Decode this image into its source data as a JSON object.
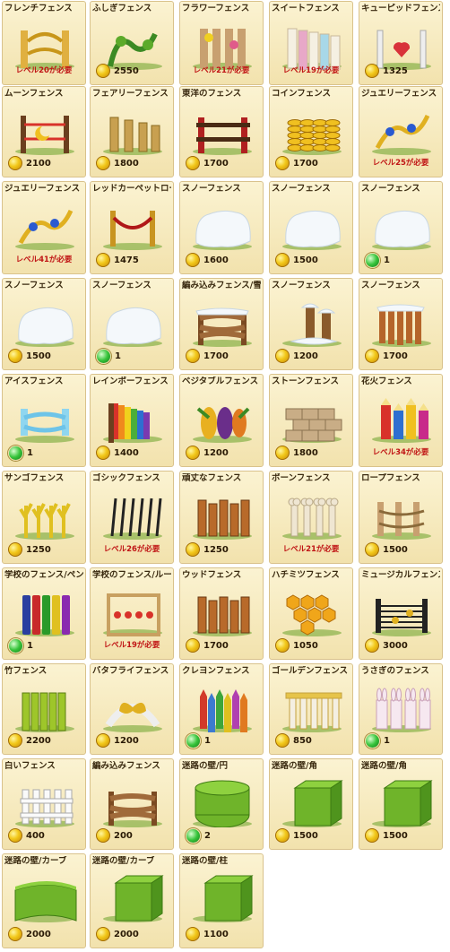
{
  "items": [
    {
      "name": "フレンチフェンス",
      "requirement": "レベル20が必要",
      "art": "ornate-gold"
    },
    {
      "name": "ふしぎフェンス",
      "price": "2550",
      "currency": "coin",
      "art": "vine"
    },
    {
      "name": "フラワーフェンス",
      "requirement": "レベル21が必要",
      "art": "flower"
    },
    {
      "name": "スイートフェンス",
      "requirement": "レベル19が必要",
      "art": "sweet"
    },
    {
      "name": "キューピッドフェンス",
      "price": "1325",
      "currency": "coin",
      "art": "cupid"
    },
    {
      "name": "ムーンフェンス",
      "price": "2100",
      "currency": "coin",
      "art": "moon"
    },
    {
      "name": "フェアリーフェンス",
      "price": "1800",
      "currency": "coin",
      "art": "fairy"
    },
    {
      "name": "東洋のフェンス",
      "price": "1700",
      "currency": "coin",
      "art": "oriental"
    },
    {
      "name": "コインフェンス",
      "price": "1700",
      "currency": "coin",
      "art": "coin-stack"
    },
    {
      "name": "ジュエリーフェンス",
      "requirement": "レベル25が必要",
      "art": "jewel"
    },
    {
      "name": "ジュエリーフェンス",
      "requirement": "レベル41が必要",
      "art": "jewel"
    },
    {
      "name": "レッドカーペットロープ",
      "price": "1475",
      "currency": "coin",
      "art": "red-rope"
    },
    {
      "name": "スノーフェンス",
      "price": "1600",
      "currency": "coin",
      "art": "snow"
    },
    {
      "name": "スノーフェンス",
      "price": "1500",
      "currency": "coin",
      "art": "snow"
    },
    {
      "name": "スノーフェンス",
      "price": "1",
      "currency": "gem",
      "art": "snow"
    },
    {
      "name": "スノーフェンス",
      "price": "1500",
      "currency": "coin",
      "art": "snow"
    },
    {
      "name": "スノーフェンス",
      "price": "1",
      "currency": "gem",
      "art": "snow"
    },
    {
      "name": "編み込みフェンス/雪",
      "price": "1700",
      "currency": "coin",
      "art": "woven-snow"
    },
    {
      "name": "スノーフェンス",
      "price": "1200",
      "currency": "coin",
      "art": "snow-post"
    },
    {
      "name": "スノーフェンス",
      "price": "1700",
      "currency": "coin",
      "art": "picket-snow"
    },
    {
      "name": "アイスフェンス",
      "price": "1",
      "currency": "gem",
      "art": "ice"
    },
    {
      "name": "レインボーフェンス",
      "price": "1400",
      "currency": "coin",
      "art": "rainbow"
    },
    {
      "name": "ベジタブルフェンス",
      "price": "1200",
      "currency": "coin",
      "art": "vegetable"
    },
    {
      "name": "ストーンフェンス",
      "price": "1800",
      "currency": "coin",
      "art": "stone"
    },
    {
      "name": "花火フェンス",
      "requirement": "レベル34が必要",
      "art": "firework"
    },
    {
      "name": "サンゴフェンス",
      "price": "1250",
      "currency": "coin",
      "art": "coral"
    },
    {
      "name": "ゴシックフェンス",
      "requirement": "レベル26が必要",
      "art": "gothic"
    },
    {
      "name": "頑丈なフェンス",
      "price": "1250",
      "currency": "coin",
      "art": "sturdy"
    },
    {
      "name": "ボーンフェンス",
      "requirement": "レベル21が必要",
      "art": "bone"
    },
    {
      "name": "ロープフェンス",
      "price": "1500",
      "currency": "coin",
      "art": "rope"
    },
    {
      "name": "学校のフェンス/ペン",
      "price": "1",
      "currency": "gem",
      "art": "pens"
    },
    {
      "name": "学校のフェンス/ルーラー",
      "requirement": "レベル19が必要",
      "art": "ruler"
    },
    {
      "name": "ウッドフェンス",
      "price": "1700",
      "currency": "coin",
      "art": "wood"
    },
    {
      "name": "ハチミツフェンス",
      "price": "1050",
      "currency": "coin",
      "art": "honey"
    },
    {
      "name": "ミュージカルフェンス",
      "price": "3000",
      "currency": "coin",
      "art": "music"
    },
    {
      "name": "竹フェンス",
      "price": "2200",
      "currency": "coin",
      "art": "bamboo"
    },
    {
      "name": "バタフライフェンス",
      "price": "1200",
      "currency": "coin",
      "art": "butterfly"
    },
    {
      "name": "クレヨンフェンス",
      "price": "1",
      "currency": "gem",
      "art": "crayon"
    },
    {
      "name": "ゴールデンフェンス",
      "price": "850",
      "currency": "coin",
      "art": "golden"
    },
    {
      "name": "うさぎのフェンス",
      "price": "1",
      "currency": "gem",
      "art": "bunny"
    },
    {
      "name": "白いフェンス",
      "price": "400",
      "currency": "coin",
      "art": "white"
    },
    {
      "name": "編み込みフェンス",
      "price": "200",
      "currency": "coin",
      "art": "woven"
    },
    {
      "name": "迷路の壁/円",
      "price": "2",
      "currency": "gem",
      "art": "hedge-round"
    },
    {
      "name": "迷路の壁/角",
      "price": "1500",
      "currency": "coin",
      "art": "hedge-corner"
    },
    {
      "name": "迷路の壁/角",
      "price": "1500",
      "currency": "coin",
      "art": "hedge-corner"
    },
    {
      "name": "迷路の壁/カーブ",
      "price": "2000",
      "currency": "coin",
      "art": "hedge-curve"
    },
    {
      "name": "迷路の壁/カーブ",
      "price": "2000",
      "currency": "coin",
      "art": "hedge-pillar"
    },
    {
      "name": "迷路の壁/柱",
      "price": "1100",
      "currency": "coin",
      "art": "hedge-pillar"
    }
  ]
}
